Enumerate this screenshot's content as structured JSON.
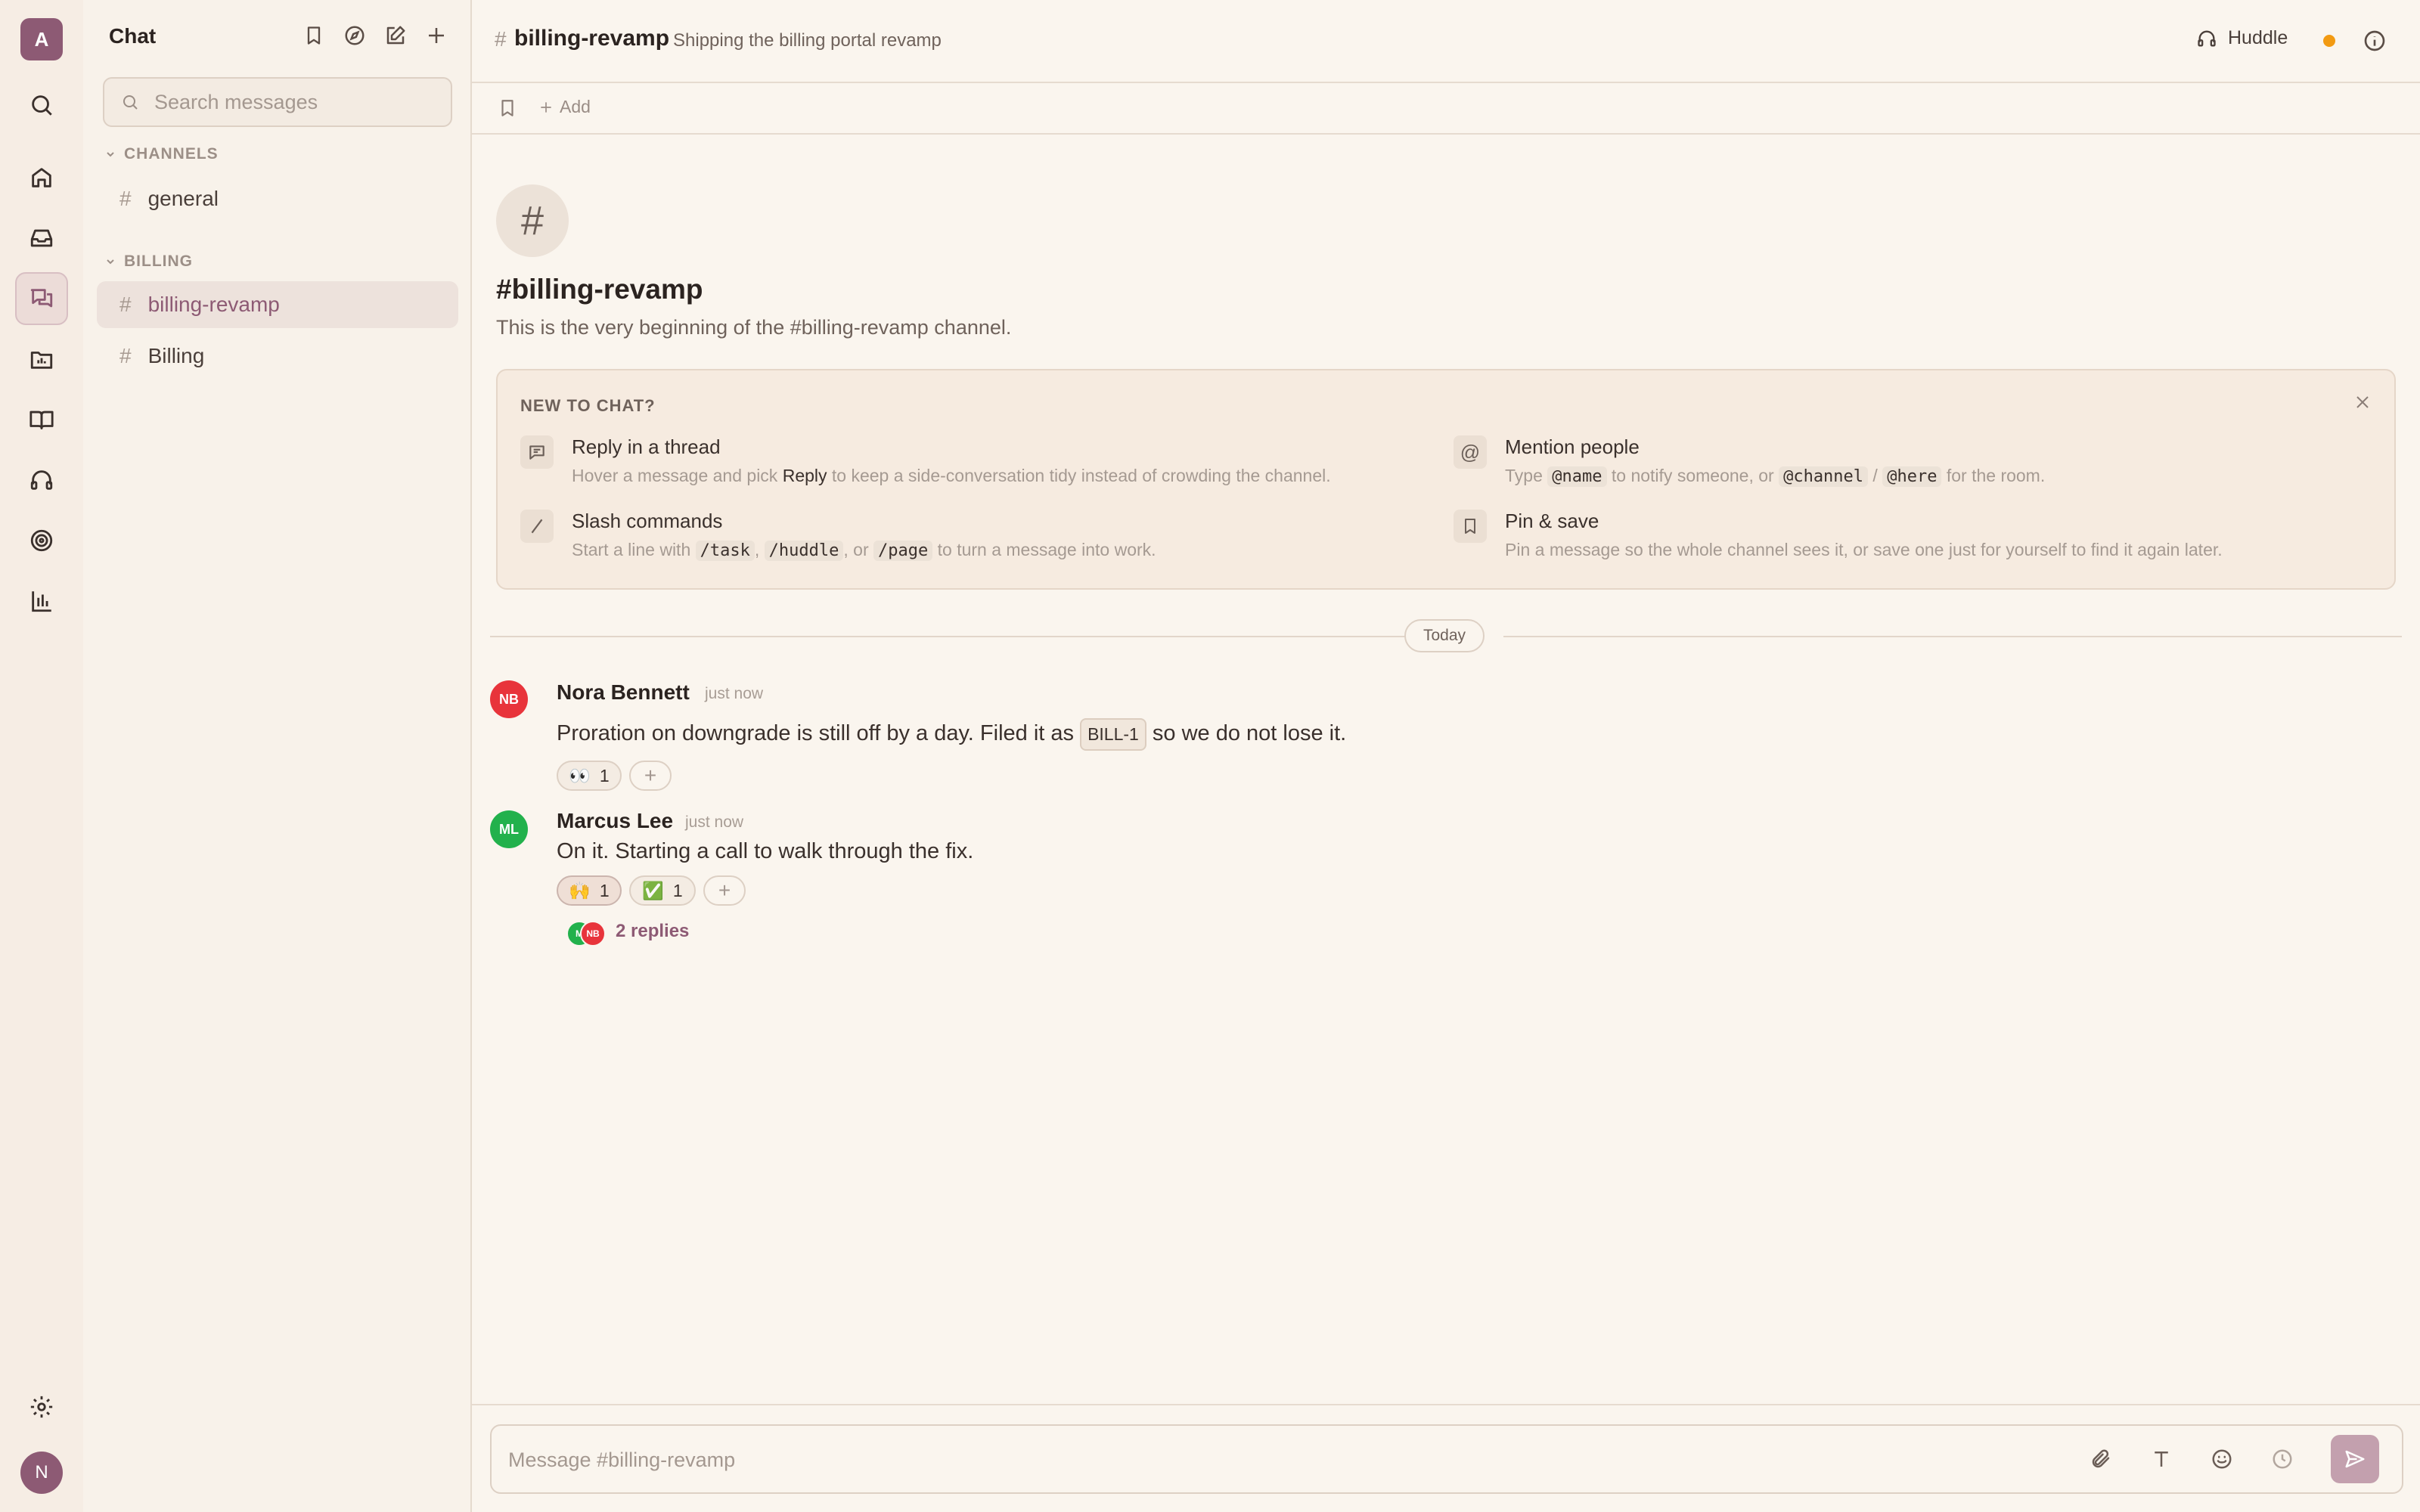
{
  "workspace": {
    "initial": "A",
    "user_initial": "N"
  },
  "sidebar": {
    "title": "Chat",
    "search_placeholder": "Search messages",
    "sections": [
      {
        "label": "CHANNELS",
        "channels": [
          {
            "name": "general",
            "active": false
          }
        ]
      },
      {
        "label": "BILLING",
        "channels": [
          {
            "name": "billing-revamp",
            "active": true
          },
          {
            "name": "Billing",
            "active": false
          }
        ]
      }
    ]
  },
  "header": {
    "hash": "#",
    "channel": "billing-revamp",
    "topic": "Shipping the billing portal revamp",
    "huddle_label": "Huddle",
    "status_color": "#f29a12"
  },
  "subbar": {
    "add_label": "Add"
  },
  "intro": {
    "icon_glyph": "#",
    "title": "#billing-revamp",
    "subtitle": "This is the very beginning of the #billing-revamp channel."
  },
  "tips": {
    "heading": "NEW TO CHAT?",
    "items": [
      {
        "title": "Reply in a thread",
        "d1": "Hover a message and pick ",
        "d_bold": "Reply",
        "d2": " to keep a side-conversation tidy instead of crowding the channel."
      },
      {
        "title": "Mention people",
        "d1": "Type ",
        "c1": "@name",
        "d2": " to notify someone, or ",
        "c2": "@channel",
        "d3": " / ",
        "c3": "@here",
        "d4": " for the room."
      },
      {
        "title": "Slash commands",
        "d1": "Start a line with ",
        "c1": "/task",
        "d2": ", ",
        "c2": "/huddle",
        "d3": ", or ",
        "c3": "/page",
        "d4": " to turn a message into work."
      },
      {
        "title": "Pin & save",
        "d1": "Pin a message so the whole channel sees it, or save one just for yourself to find it again later."
      }
    ]
  },
  "divider": {
    "label": "Today"
  },
  "messages": [
    {
      "initials": "NB",
      "author": "Nora Bennett",
      "time": "just now",
      "color": "#e8343b",
      "text1": "Proration on downgrade is still off by a day. Filed it as ",
      "tag": "BILL-1",
      "text2": " so we do not lose it.",
      "reactions": [
        {
          "emoji": "👀",
          "count": "1"
        }
      ]
    },
    {
      "initials": "ML",
      "author": "Marcus Lee",
      "time": "just now",
      "color": "#22b14c",
      "text1": "On it. Starting a call to walk through the fix.",
      "reactions": [
        {
          "emoji": "🙌",
          "count": "1"
        },
        {
          "emoji": "✅",
          "count": "1"
        }
      ],
      "replies": "2 replies",
      "reply_avatars": [
        "M",
        "NB"
      ]
    }
  ],
  "composer": {
    "placeholder": "Message #billing-revamp"
  },
  "icons": {
    "rail": [
      "search-icon",
      "home-icon",
      "inbox-icon",
      "chat-icon",
      "files-icon",
      "docs-icon",
      "huddle-icon",
      "goals-icon",
      "analytics-icon",
      "settings-icon"
    ],
    "accent": "#8d5a74"
  }
}
